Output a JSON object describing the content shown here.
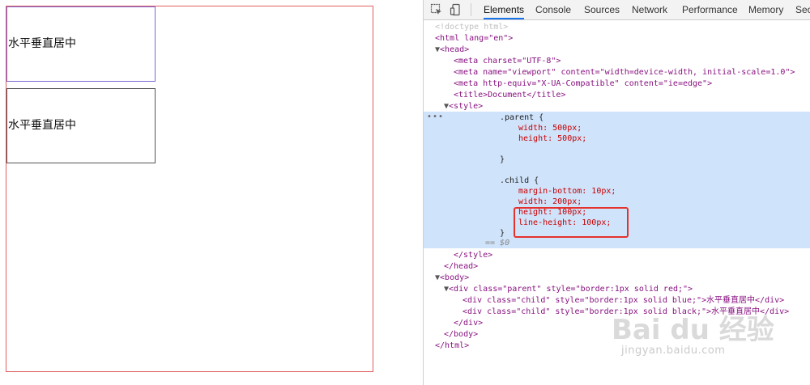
{
  "viewport": {
    "child_text_1": "水平垂直居中",
    "child_text_2": "水平垂直居中"
  },
  "devtools": {
    "tabs": [
      "Elements",
      "Console",
      "Sources",
      "Network",
      "Performance",
      "Memory",
      "Sec"
    ],
    "active_tab": "Elements",
    "code": {
      "doctype": "<!doctype html>",
      "html_open": "<html lang=\"en\">",
      "head_open": "<head>",
      "meta1": "<meta charset=\"UTF-8\">",
      "meta2": "<meta name=\"viewport\" content=\"width=device-width, initial-scale=1.0\">",
      "meta3": "<meta http-equiv=\"X-UA-Compatible\" content=\"ie=edge\">",
      "title": "<title>Document</title>",
      "style_open": "<style>",
      "parent_sel": ".parent {",
      "parent_width": "width: 500px;",
      "parent_height": "height: 500px;",
      "close_brace": "}",
      "child_sel": ".child {",
      "child_margin": "margin-bottom: 10px;",
      "child_width": "width: 200px;",
      "child_height": "height: 100px;",
      "child_lh": "line-height: 100px;",
      "eq0": "== $0",
      "style_close": "</style>",
      "head_close": "</head>",
      "body_open": "<body>",
      "div_parent": "<div class=\"parent\" style=\"border:1px solid red;\">",
      "div_child1": "<div class=\"child\" style=\"border:1px solid blue;\">水平垂直居中</div>",
      "div_child2": "<div class=\"child\" style=\"border:1px solid black;\">水平垂直居中</div>",
      "div_close": "</div>",
      "body_close": "</body>",
      "html_close": "</html>"
    }
  },
  "watermark": {
    "logo": "Bai du 经验",
    "url": "jingyan.baidu.com"
  }
}
